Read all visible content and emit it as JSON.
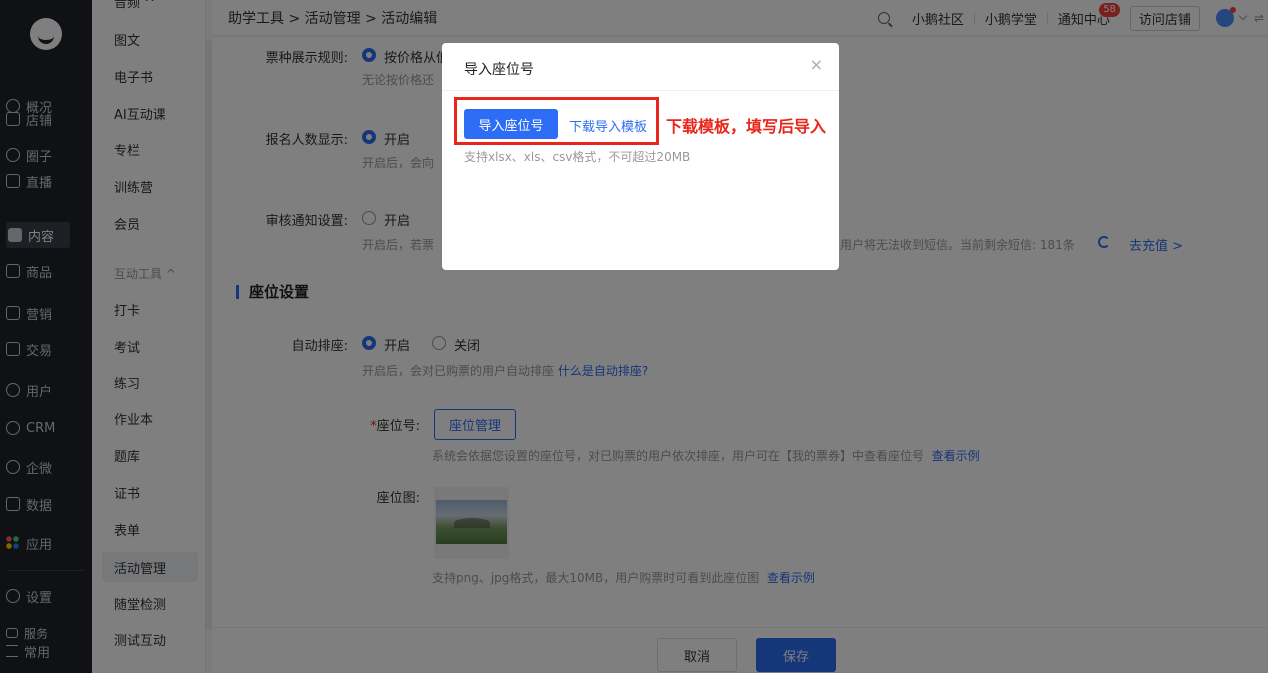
{
  "rail": {
    "items": [
      {
        "label": "概况",
        "icon": "clock-icon"
      },
      {
        "label": "店铺",
        "icon": "store-icon"
      },
      {
        "label": "圈子",
        "icon": "community-icon"
      },
      {
        "label": "直播",
        "icon": "live-icon"
      },
      {
        "label": "内容",
        "icon": "content-icon"
      },
      {
        "label": "商品",
        "icon": "goods-icon"
      },
      {
        "label": "营销",
        "icon": "marketing-icon"
      },
      {
        "label": "交易",
        "icon": "trade-icon"
      },
      {
        "label": "用户",
        "icon": "user-icon"
      },
      {
        "label": "CRM",
        "icon": "crm-icon"
      },
      {
        "label": "企微",
        "icon": "wecom-icon"
      },
      {
        "label": "数据",
        "icon": "data-icon"
      },
      {
        "label": "应用",
        "icon": "apps-icon"
      },
      {
        "label": "设置",
        "icon": "settings-icon"
      },
      {
        "label": "服务",
        "icon": "service-icon"
      },
      {
        "label": "常用",
        "icon": "frequent-icon"
      }
    ]
  },
  "submenu": {
    "top_partial": "音频 ^",
    "items": [
      "图文",
      "电子书",
      "AI互动课",
      "专栏",
      "训练营",
      "会员"
    ],
    "group_label": "互动工具 ^",
    "group_items": [
      "打卡",
      "考试",
      "练习",
      "作业本",
      "题库",
      "证书",
      "表单",
      "活动管理",
      "随堂检测",
      "测试互动"
    ]
  },
  "topbar": {
    "breadcrumb": "助学工具 > 活动管理 > 活动编辑",
    "links": [
      "小鹅社区",
      "小鹅学堂",
      "通知中心"
    ],
    "notice_badge": "58",
    "visit_store": "访问店铺",
    "swap": "⇌"
  },
  "form": {
    "ticket_rule_label": "票种展示规则:",
    "ticket_rule_option": "按价格从低",
    "ticket_rule_hint": "无论按价格还",
    "signup_label": "报名人数显示:",
    "signup_on": "开启",
    "signup_hint": "开启后，会向",
    "review_label": "审核通知设置:",
    "review_on": "开启",
    "review_hint": "开启后，若票",
    "review_hint_right": "用户将无法收到短信。当前剩余短信: 181条",
    "recharge": "去充值 >",
    "section_title": "座位设置",
    "auto_seat_label": "自动排座:",
    "auto_seat_on": "开启",
    "auto_seat_off": "关闭",
    "auto_seat_hint": "开启后，会对已购票的用户自动排座",
    "auto_seat_link": "什么是自动排座?",
    "seat_no_label": "座位号:",
    "seat_manage_btn": "座位管理",
    "seat_no_hint": "系统会依据您设置的座位号，对已购票的用户依次排座，用户可在【我的票券】中查看座位号",
    "seat_no_link": "查看示例",
    "seat_map_label": "座位图:",
    "seat_map_hint": "支持png、jpg格式，最大10MB，用户购票时可看到此座位图",
    "seat_map_link": "查看示例"
  },
  "bottombar": {
    "cancel": "取消",
    "save": "保存"
  },
  "modal": {
    "title": "导入座位号",
    "close": "×",
    "import_btn": "导入座位号",
    "download_link": "下载导入模板",
    "hint": "支持xlsx、xls、csv格式，不可超过20MB"
  },
  "annotation": "下载模板，填写后导入"
}
